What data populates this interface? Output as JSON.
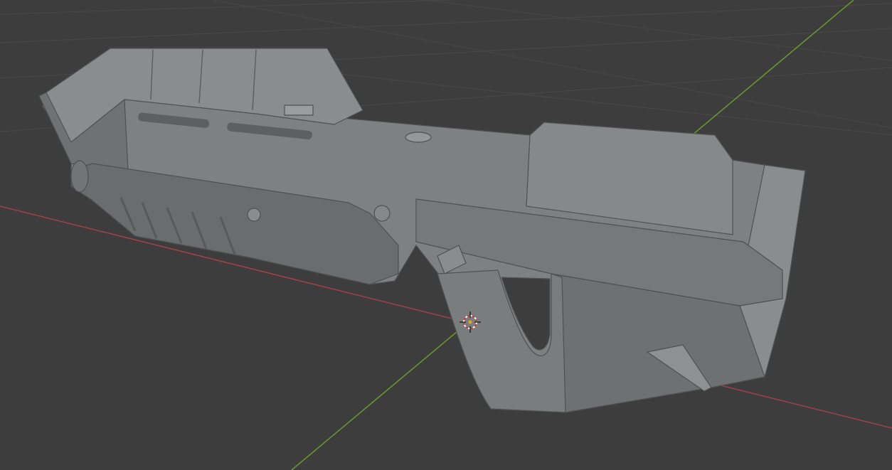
{
  "viewport": {
    "background_color": "#3d3d3d",
    "grid_color": "#474747",
    "x_axis_color": "#a3404d",
    "y_axis_color": "#6a9a2a",
    "model_color": "#7a7d7e",
    "icons": [
      "3d-cursor-icon"
    ]
  }
}
